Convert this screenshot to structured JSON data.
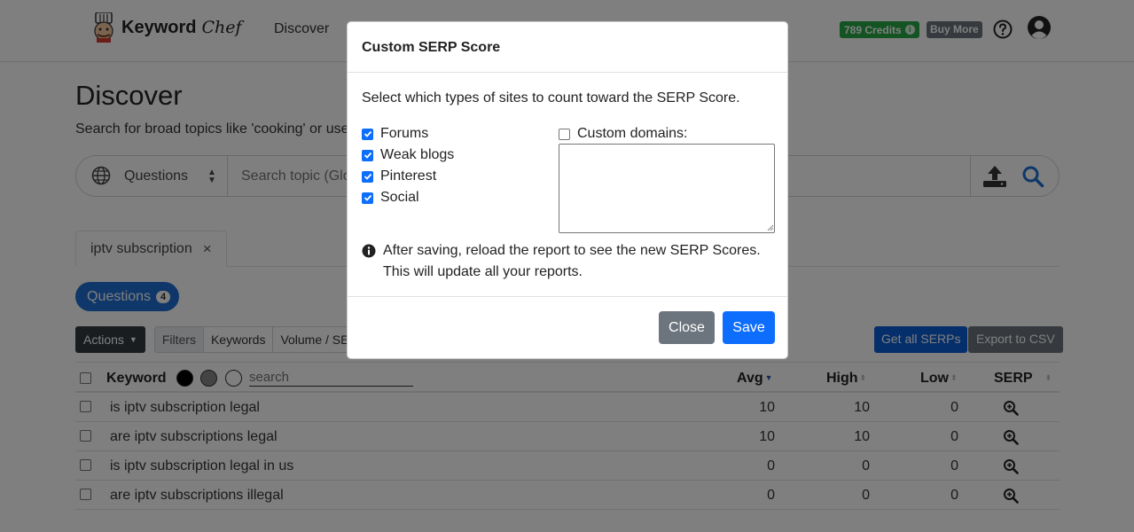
{
  "navbar": {
    "brand_word": "Keyword",
    "brand_script": "Chef",
    "discover_link": "Discover",
    "credits_label": "789 Credits",
    "credits_info": "i",
    "buy_more": "Buy More",
    "logo_icon": "chef-logo-icon",
    "help_icon": "question-circle-icon",
    "user_icon": "user-circle-icon"
  },
  "page": {
    "title": "Discover",
    "subtitle": "Search for broad topics like 'cooking' or use"
  },
  "search": {
    "type_selected": "Questions",
    "placeholder": "Search topic (Glo",
    "globe_icon": "globe-icon",
    "upload_icon": "upload-icon",
    "search_icon": "search-icon"
  },
  "tabs": [
    {
      "label": "iptv subscription",
      "close": "×"
    }
  ],
  "questions_pill": {
    "label": "Questions",
    "count": "4"
  },
  "toolbar": {
    "actions": "Actions",
    "filters": "Filters",
    "keywords": "Keywords",
    "volume": "Volume / SEF",
    "get_all_serps": "Get all SERPs",
    "export_csv": "Export to CSV"
  },
  "table": {
    "headers": {
      "keyword": "Keyword",
      "search_placeholder": "search",
      "avg": "Avg",
      "high": "High",
      "low": "Low",
      "serp": "SERP"
    },
    "rows": [
      {
        "keyword": "is iptv subscription legal",
        "avg": "10",
        "high": "10",
        "low": "0"
      },
      {
        "keyword": "are iptv subscriptions legal",
        "avg": "10",
        "high": "10",
        "low": "0"
      },
      {
        "keyword": "is iptv subscription legal in us",
        "avg": "0",
        "high": "0",
        "low": "0"
      },
      {
        "keyword": "are iptv subscriptions illegal",
        "avg": "0",
        "high": "0",
        "low": "0"
      }
    ]
  },
  "modal": {
    "title": "Custom SERP Score",
    "intro": "Select which types of sites to count toward the SERP Score.",
    "options": [
      {
        "label": "Forums",
        "checked": true
      },
      {
        "label": "Weak blogs",
        "checked": true
      },
      {
        "label": "Pinterest",
        "checked": true
      },
      {
        "label": "Social",
        "checked": true
      }
    ],
    "custom_domains_label": "Custom domains:",
    "custom_domains_checked": false,
    "note_line1": "After saving, reload the report to see the new SERP Scores.",
    "note_line2": "This will update all your reports.",
    "close_button": "Close",
    "save_button": "Save"
  },
  "colors": {
    "primary": "#0d6efd",
    "pill": "#1f6fd3",
    "success": "#28a745",
    "secondary": "#6c757d",
    "dark": "#343a40"
  }
}
